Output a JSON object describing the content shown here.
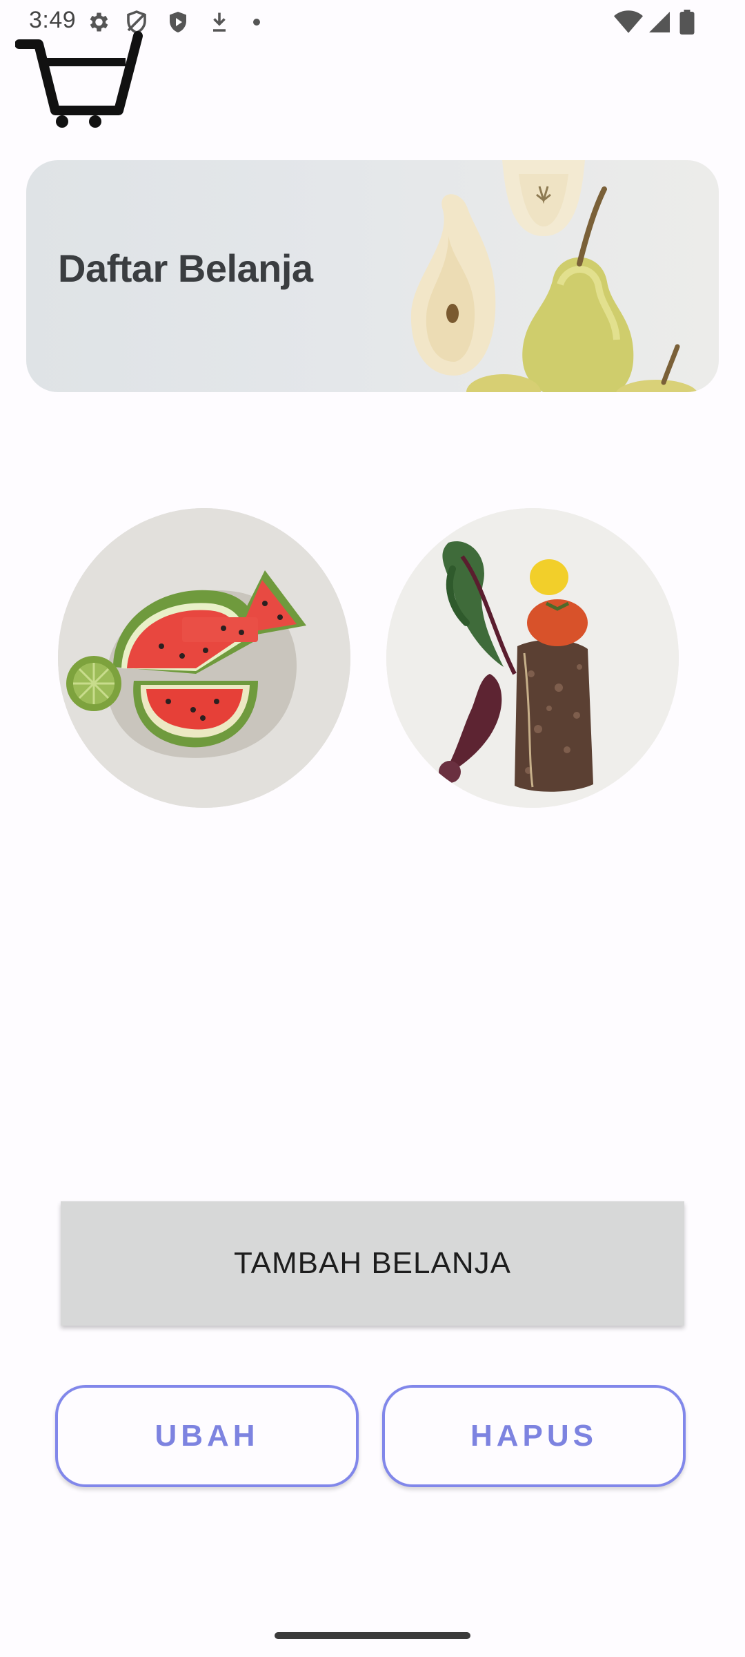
{
  "status_bar": {
    "time": "3:49",
    "icons": [
      "settings-icon",
      "vpn-shield-icon",
      "play-protect-icon",
      "download-icon",
      "notification-dot-icon",
      "wifi-icon",
      "signal-icon",
      "battery-icon"
    ]
  },
  "app": {
    "logo_icon": "shopping-cart-icon"
  },
  "banner": {
    "title": "Daftar Belanja"
  },
  "photos": [
    {
      "name": "watermelon"
    },
    {
      "name": "vegetables"
    }
  ],
  "actions": {
    "add_label": "TAMBAH BELANJA",
    "edit_label": "UBAH",
    "delete_label": "HAPUS"
  },
  "colors": {
    "accent": "#7d83e0",
    "button_gray": "#d7d8d8",
    "background": "#fefcff"
  }
}
